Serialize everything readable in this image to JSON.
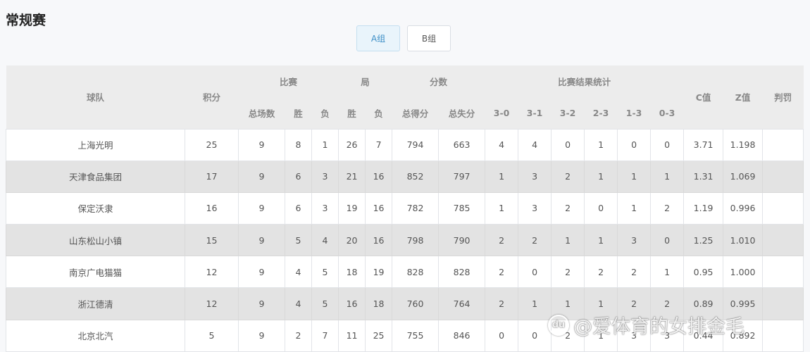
{
  "page": {
    "title": "常规赛"
  },
  "tabs": [
    {
      "label": "A组",
      "active": true
    },
    {
      "label": "B组",
      "active": false
    }
  ],
  "table": {
    "headers": {
      "team": "球队",
      "points": "积分",
      "matches": "比赛",
      "games": "局",
      "scores": "分数",
      "result_stats": "比赛结果统计",
      "c_value": "C值",
      "z_value": "Z值",
      "penalty": "判罚",
      "total_matches": "总场数",
      "win": "胜",
      "loss": "负",
      "game_win": "胜",
      "game_loss": "负",
      "points_for": "总得分",
      "points_against": "总失分",
      "r30": "3-0",
      "r31": "3-1",
      "r32": "3-2",
      "r23": "2-3",
      "r13": "1-3",
      "r03": "0-3"
    },
    "rows": [
      [
        "上海光明",
        "25",
        "9",
        "8",
        "1",
        "26",
        "7",
        "794",
        "663",
        "4",
        "4",
        "0",
        "1",
        "0",
        "0",
        "3.71",
        "1.198",
        ""
      ],
      [
        "天津食品集团",
        "17",
        "9",
        "6",
        "3",
        "21",
        "16",
        "852",
        "797",
        "1",
        "3",
        "2",
        "1",
        "1",
        "1",
        "1.31",
        "1.069",
        ""
      ],
      [
        "保定沃隶",
        "16",
        "9",
        "6",
        "3",
        "19",
        "16",
        "782",
        "785",
        "1",
        "3",
        "2",
        "0",
        "1",
        "2",
        "1.19",
        "0.996",
        ""
      ],
      [
        "山东松山小镇",
        "15",
        "9",
        "5",
        "4",
        "20",
        "16",
        "798",
        "790",
        "2",
        "2",
        "1",
        "1",
        "3",
        "0",
        "1.25",
        "1.010",
        ""
      ],
      [
        "南京广电猫猫",
        "12",
        "9",
        "4",
        "5",
        "18",
        "19",
        "828",
        "828",
        "2",
        "0",
        "2",
        "2",
        "2",
        "1",
        "0.95",
        "1.000",
        ""
      ],
      [
        "浙江德清",
        "12",
        "9",
        "4",
        "5",
        "16",
        "18",
        "760",
        "764",
        "2",
        "1",
        "1",
        "1",
        "2",
        "2",
        "0.89",
        "0.995",
        ""
      ],
      [
        "北京北汽",
        "5",
        "9",
        "2",
        "7",
        "11",
        "25",
        "755",
        "846",
        "0",
        "0",
        "2",
        "1",
        "3",
        "3",
        "0.44",
        "0.892",
        ""
      ]
    ]
  },
  "watermark": {
    "logo": "du",
    "text": "@爱体育的女排金毛"
  }
}
